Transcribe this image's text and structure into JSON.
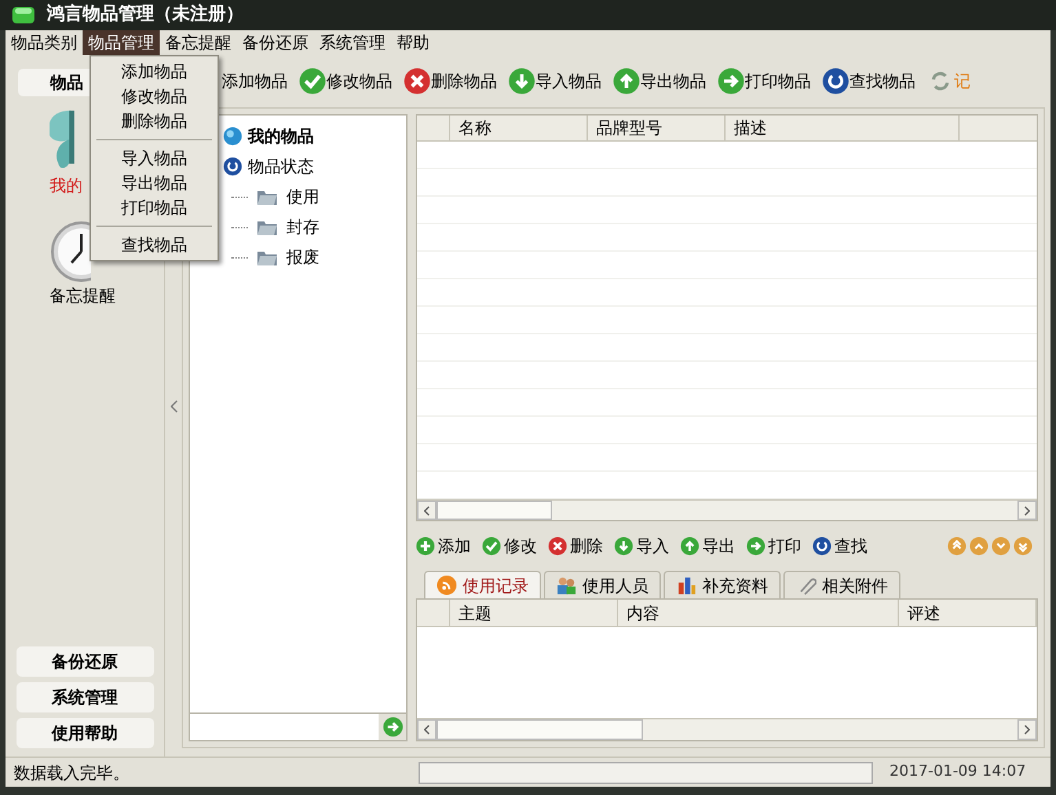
{
  "window": {
    "title": "鸿言物品管理（未注册）"
  },
  "menu_bar": [
    {
      "label": "物品类别",
      "selected": false
    },
    {
      "label": "物品管理",
      "selected": true
    },
    {
      "label": "备忘提醒",
      "selected": false
    },
    {
      "label": "备份还原",
      "selected": false
    },
    {
      "label": "系统管理",
      "selected": false
    },
    {
      "label": "帮助",
      "selected": false
    }
  ],
  "dropdown": [
    {
      "kind": "item",
      "label": "添加物品"
    },
    {
      "kind": "item",
      "label": "修改物品"
    },
    {
      "kind": "item",
      "label": "删除物品"
    },
    {
      "kind": "separator"
    },
    {
      "kind": "item",
      "label": "导入物品"
    },
    {
      "kind": "item",
      "label": "导出物品"
    },
    {
      "kind": "item",
      "label": "打印物品"
    },
    {
      "kind": "separator"
    },
    {
      "kind": "item",
      "label": "查找物品"
    }
  ],
  "sidebar": {
    "header": "物品",
    "items": [
      {
        "kind": "butterfly",
        "label": "我的",
        "selected": true
      },
      {
        "kind": "clock",
        "label": "备忘提醒",
        "selected": false
      }
    ],
    "buttons": [
      "备份还原",
      "系统管理",
      "使用帮助"
    ]
  },
  "toolbar": [
    {
      "label": "添加物品"
    },
    {
      "kind": "edit",
      "label": "修改物品"
    },
    {
      "kind": "delete",
      "label": "删除物品"
    },
    {
      "kind": "import",
      "label": "导入物品"
    },
    {
      "kind": "export",
      "label": "导出物品"
    },
    {
      "kind": "print",
      "label": "打印物品"
    },
    {
      "kind": "find",
      "label": "查找物品"
    },
    {
      "kind": "refresh",
      "label": "记"
    }
  ],
  "tree": [
    {
      "label": "我的物品",
      "kind": "root"
    },
    {
      "label": "物品状态",
      "kind": "status",
      "children": [
        {
          "label": "使用"
        },
        {
          "label": "封存"
        },
        {
          "label": "报废"
        }
      ]
    }
  ],
  "items_table": {
    "columns": [
      "名称",
      "品牌型号",
      "描述"
    ]
  },
  "sub_toolbar": [
    {
      "kind": "add",
      "label": "添加"
    },
    {
      "kind": "edit",
      "label": "修改"
    },
    {
      "kind": "delete",
      "label": "删除"
    },
    {
      "kind": "import",
      "label": "导入"
    },
    {
      "kind": "export",
      "label": "导出"
    },
    {
      "kind": "print",
      "label": "打印"
    },
    {
      "kind": "find",
      "label": "查找"
    }
  ],
  "tabs": [
    {
      "kind": "rss",
      "label": "使用记录",
      "selected": true
    },
    {
      "kind": "people",
      "label": "使用人员",
      "selected": false
    },
    {
      "kind": "chart",
      "label": "补充资料",
      "selected": false
    },
    {
      "kind": "clip",
      "label": "相关附件",
      "selected": false
    }
  ],
  "records_table": {
    "columns": [
      "主题",
      "内容",
      "评述"
    ]
  },
  "status_bar": {
    "message": "数据载入完毕。",
    "datetime": "2017-01-09 14:07"
  }
}
